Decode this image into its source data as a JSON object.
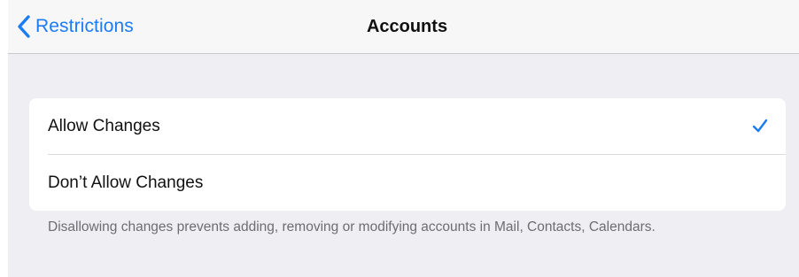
{
  "nav": {
    "back_label": "Restrictions",
    "title": "Accounts"
  },
  "options": [
    {
      "label": "Allow Changes",
      "selected": true
    },
    {
      "label": "Don’t Allow Changes",
      "selected": false
    }
  ],
  "footer": {
    "note": "Disallowing changes prevents adding, removing or modifying accounts in Mail, Contacts, Calendars."
  },
  "icons": {
    "back": "chevron-left-icon",
    "selected": "checkmark-icon"
  },
  "colors": {
    "accent": "#1b7cf5",
    "background": "#eeeef3",
    "nav_background": "#f7f7f8",
    "footer_text": "#6d6d72"
  }
}
